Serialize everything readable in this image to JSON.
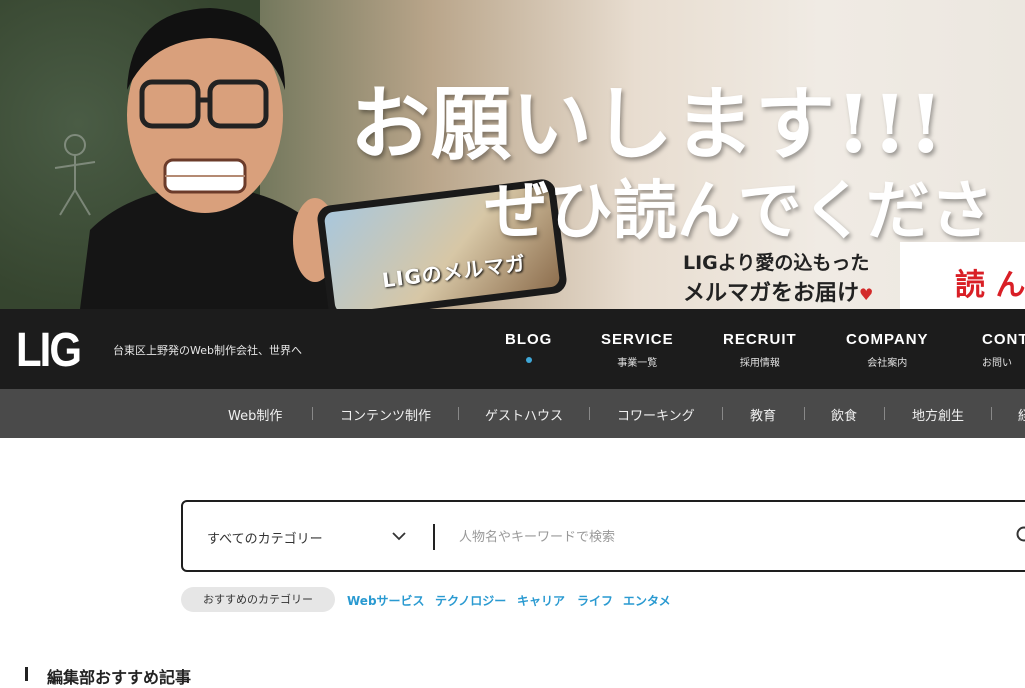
{
  "hero": {
    "headline_1": "お願いします!!!",
    "headline_2": "ぜひ読んでくださ",
    "phone_text": "LIGのメルマガ",
    "sub_line_1": "LIGより愛の込もった",
    "sub_line_2": "メルマガをお届け",
    "heart": "♥",
    "tag": "読 ん"
  },
  "header": {
    "logo": "LIG",
    "tagline": "台東区上野発のWeb制作会社、世界へ",
    "nav": [
      {
        "en": "BLOG",
        "ja": ""
      },
      {
        "en": "SERVICE",
        "ja": "事業一覧"
      },
      {
        "en": "RECRUIT",
        "ja": "採用情報"
      },
      {
        "en": "COMPANY",
        "ja": "会社案内"
      },
      {
        "en": "CONT",
        "ja": "お問い"
      }
    ],
    "active_color": "#3fa8d8"
  },
  "subnav": {
    "items": [
      "Web制作",
      "コンテンツ制作",
      "ゲストハウス",
      "コワーキング",
      "教育",
      "飲食",
      "地方創生",
      "経"
    ]
  },
  "search": {
    "category_label": "すべてのカテゴリー",
    "placeholder": "人物名やキーワードで検索"
  },
  "recommended": {
    "badge": "おすすめのカテゴリー",
    "links": [
      "Webサービス",
      "テクノロジー",
      "キャリア",
      "ライフ",
      "エンタメ"
    ],
    "link_color": "#2a9ad1"
  },
  "section": {
    "title": "編集部おすすめ記事"
  }
}
